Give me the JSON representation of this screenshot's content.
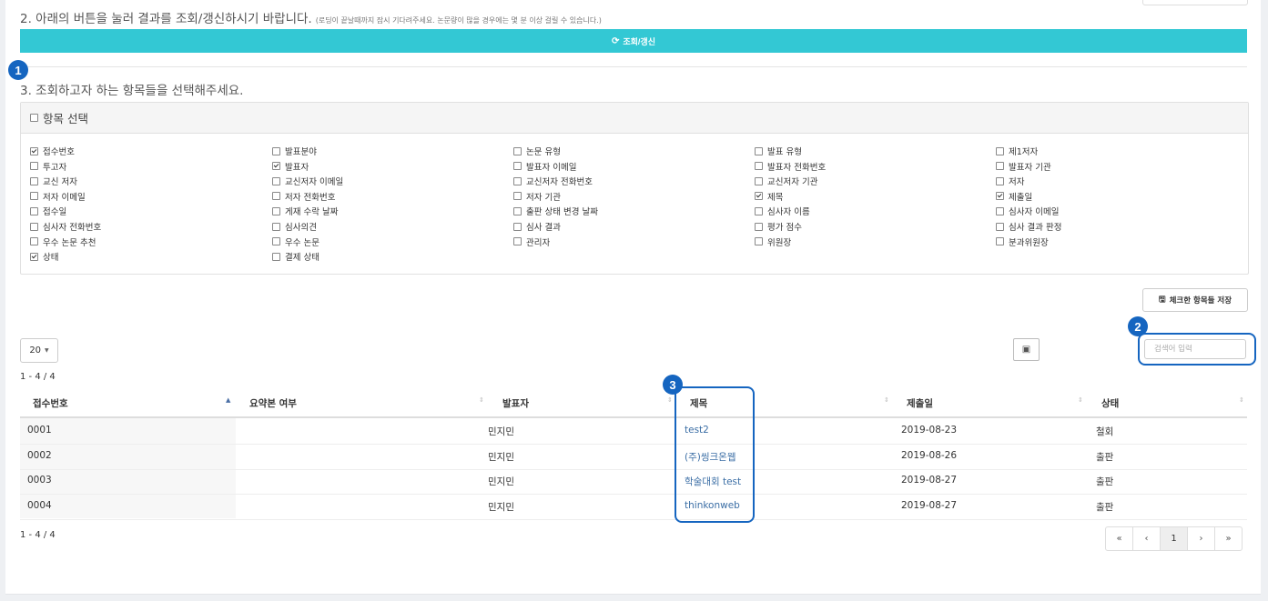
{
  "step2": {
    "title": "2. 아래의 버튼을 눌러 결과를 조회/갱신하시기 바랍니다.",
    "note": "(로딩이 끝날때까지 잠시 기다려주세요. 논문량이 많을 경우에는 몇 분 이상 걸릴 수 있습니다.)",
    "button_label": "조회/갱신"
  },
  "step3": {
    "title": "3. 조회하고자 하는 항목들을 선택해주세요."
  },
  "item_select": {
    "header": "항목 선택",
    "columns": [
      [
        {
          "label": "접수번호",
          "checked": true
        },
        {
          "label": "투고자",
          "checked": false
        },
        {
          "label": "교신 저자",
          "checked": false
        },
        {
          "label": "저자 이메일",
          "checked": false
        },
        {
          "label": "접수일",
          "checked": false
        },
        {
          "label": "심사자 전화번호",
          "checked": false
        },
        {
          "label": "우수 논문 추천",
          "checked": false
        },
        {
          "label": "상태",
          "checked": true
        }
      ],
      [
        {
          "label": "발표분야",
          "checked": false
        },
        {
          "label": "발표자",
          "checked": true
        },
        {
          "label": "교신저자 이메일",
          "checked": false
        },
        {
          "label": "저자 전화번호",
          "checked": false
        },
        {
          "label": "게재 수락 날짜",
          "checked": false
        },
        {
          "label": "심사의견",
          "checked": false
        },
        {
          "label": "우수 논문",
          "checked": false
        },
        {
          "label": "결제 상태",
          "checked": false
        }
      ],
      [
        {
          "label": "논문 유형",
          "checked": false
        },
        {
          "label": "발표자 이메일",
          "checked": false
        },
        {
          "label": "교신저자 전화번호",
          "checked": false
        },
        {
          "label": "저자 기관",
          "checked": false
        },
        {
          "label": "출판 상태 변경 날짜",
          "checked": false
        },
        {
          "label": "심사 결과",
          "checked": false
        },
        {
          "label": "관리자",
          "checked": false
        }
      ],
      [
        {
          "label": "발표 유형",
          "checked": false
        },
        {
          "label": "발표자 전화번호",
          "checked": false
        },
        {
          "label": "교신저자 기관",
          "checked": false
        },
        {
          "label": "제목",
          "checked": true
        },
        {
          "label": "심사자 이름",
          "checked": false
        },
        {
          "label": "평가 점수",
          "checked": false
        },
        {
          "label": "위원장",
          "checked": false
        }
      ],
      [
        {
          "label": "제1저자",
          "checked": false
        },
        {
          "label": "발표자 기관",
          "checked": false
        },
        {
          "label": "저자",
          "checked": false
        },
        {
          "label": "제출일",
          "checked": true
        },
        {
          "label": "심사자 이메일",
          "checked": false
        },
        {
          "label": "심사 결과 판정",
          "checked": false
        },
        {
          "label": "분과위원장",
          "checked": false
        }
      ]
    ],
    "save_button_label": "체크한 항목들 저장"
  },
  "table_controls": {
    "page_size": "20",
    "search_placeholder": "검색어 입력",
    "count_top": "1 - 4 / 4",
    "count_bottom": "1 - 4 / 4"
  },
  "table": {
    "headers": [
      "접수번호",
      "요약본 여부",
      "발표자",
      "제목",
      "제출일",
      "상태"
    ],
    "rows": [
      [
        "0001",
        "",
        "민지민",
        "test2",
        "2019-08-23",
        "철회"
      ],
      [
        "0002",
        "",
        "민지민",
        "(주)씽크온웹",
        "2019-08-26",
        "출판"
      ],
      [
        "0003",
        "",
        "민지민",
        "학술대회 test",
        "2019-08-27",
        "출판"
      ],
      [
        "0004",
        "",
        "민지민",
        "thinkonweb",
        "2019-08-27",
        "출판"
      ]
    ]
  },
  "pagination": {
    "first": "«",
    "prev": "‹",
    "current": "1",
    "next": "›",
    "last": "»"
  },
  "markers": [
    "1",
    "2",
    "3"
  ],
  "colors": {
    "accent": "#33c8d4",
    "marker": "#1565c0",
    "link": "#3b6ea5"
  }
}
